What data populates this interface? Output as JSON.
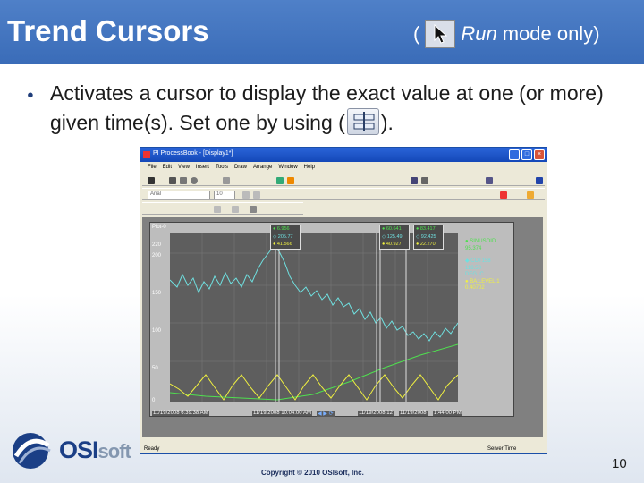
{
  "header": {
    "title": "Trend Cursors",
    "note_open": "(",
    "note_mode": "Run",
    "note_rest": "mode only)"
  },
  "body": {
    "bullet_text": "Activates a cursor to display the exact value at one (or more) given time(s). Set one by using (",
    "bullet_end": ")."
  },
  "window": {
    "title": "PI ProcessBook - [Display1*]",
    "menu": [
      "File",
      "Edit",
      "View",
      "Insert",
      "Tools",
      "Draw",
      "Arrange",
      "Window",
      "Help"
    ],
    "font_name": "Arial",
    "font_size": "10",
    "status_left": "Ready",
    "status_right": "Server Time"
  },
  "trend": {
    "name": "Plot-0",
    "y_ticks": [
      "220",
      "200",
      "150",
      "100",
      "50",
      "0"
    ],
    "start_time": "11/19/2008 6:39:38 AM",
    "cursor_time_1": "11/19/2008 10:04:00 AM",
    "cursor_time_2": "11/19/2008 12",
    "cursor_time_3": "11/19/2008",
    "end_time": "1:44:00 PM",
    "legend": [
      {
        "text": "● SINUSOID",
        "color": "#4fe04f"
      },
      {
        "text": "  95.374",
        "color": "#4fe04f"
      },
      {
        "text": "",
        "color": "#ffffff"
      },
      {
        "text": "◆ CDT158",
        "color": "#6fe0e0"
      },
      {
        "text": "  118.50",
        "color": "#6fe0e0"
      },
      {
        "text": "  DEG. C",
        "color": "#6fe0e0"
      },
      {
        "text": "● BA:LEVEL.1",
        "color": "#f0f040"
      },
      {
        "text": "  0.40702",
        "color": "#f0f040"
      }
    ],
    "cursors": [
      {
        "v1": "● 6.956",
        "v2": "◇ 205.77",
        "v3": "● 41.566"
      },
      {
        "v1": "● 60.641",
        "v2": "◇ 125.49",
        "v3": "● 40.927"
      },
      {
        "v1": "● 83.417",
        "v2": "◇ 92.425",
        "v3": "● 22.270"
      }
    ]
  },
  "footer": {
    "logo_main": "OSI",
    "logo_soft": "soft",
    "copyright": "Copyright © 2010 OSIsoft, Inc.",
    "page_number": "10"
  },
  "colors": {
    "title_bar": "#3a6cb8",
    "series_sinusoid": "#4fe04f",
    "series_cdt158": "#6fe0e0",
    "series_level": "#f0f040"
  }
}
